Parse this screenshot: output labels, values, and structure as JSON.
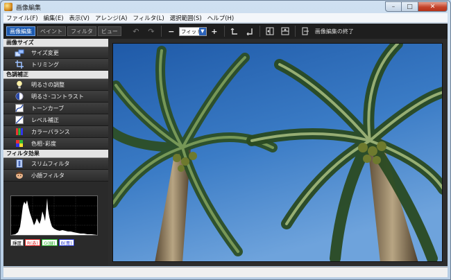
{
  "window": {
    "title": "画像編集"
  },
  "window_buttons": {
    "minimize": "–",
    "maximize": "□",
    "close": "✕"
  },
  "menu": [
    "ファイル(F)",
    "編集(E)",
    "表示(V)",
    "アレンジ(A)",
    "フィルタ(L)",
    "選択範囲(S)",
    "ヘルプ(H)"
  ],
  "tabs": [
    {
      "label": "画像編集",
      "active": true
    },
    {
      "label": "ペイント",
      "active": false
    },
    {
      "label": "フィルタ",
      "active": false
    },
    {
      "label": "ビュー",
      "active": false
    }
  ],
  "toolbar": {
    "zoom_value": "フィット",
    "zoom_out": "−",
    "zoom_in": "+",
    "exit_label": "画像編集の終了"
  },
  "sections": [
    {
      "title": "画像サイズ",
      "items": [
        {
          "label": "サイズ変更",
          "icon": "resize-icon"
        },
        {
          "label": "トリミング",
          "icon": "crop-icon"
        }
      ]
    },
    {
      "title": "色調補正",
      "items": [
        {
          "label": "明るさの調整",
          "icon": "lightbulb-icon"
        },
        {
          "label": "明るさ･コントラスト",
          "icon": "contrast-icon"
        },
        {
          "label": "トーンカーブ",
          "icon": "tone-curve-icon"
        },
        {
          "label": "レベル補正",
          "icon": "levels-icon"
        },
        {
          "label": "カラーバランス",
          "icon": "color-balance-icon"
        },
        {
          "label": "色相･彩度",
          "icon": "hue-saturation-icon"
        }
      ]
    },
    {
      "title": "フィルタ効果",
      "items": [
        {
          "label": "スリムフィルタ",
          "icon": "slim-filter-icon"
        },
        {
          "label": "小顔フィルタ",
          "icon": "small-face-filter-icon"
        }
      ]
    }
  ],
  "histogram_buttons": [
    "輝度",
    "R(赤)",
    "G(緑)",
    "B(青)"
  ],
  "colors": {
    "accent": "#1e5bb0",
    "panel": "#2a2a2a",
    "sky": "#2f6fb8"
  }
}
